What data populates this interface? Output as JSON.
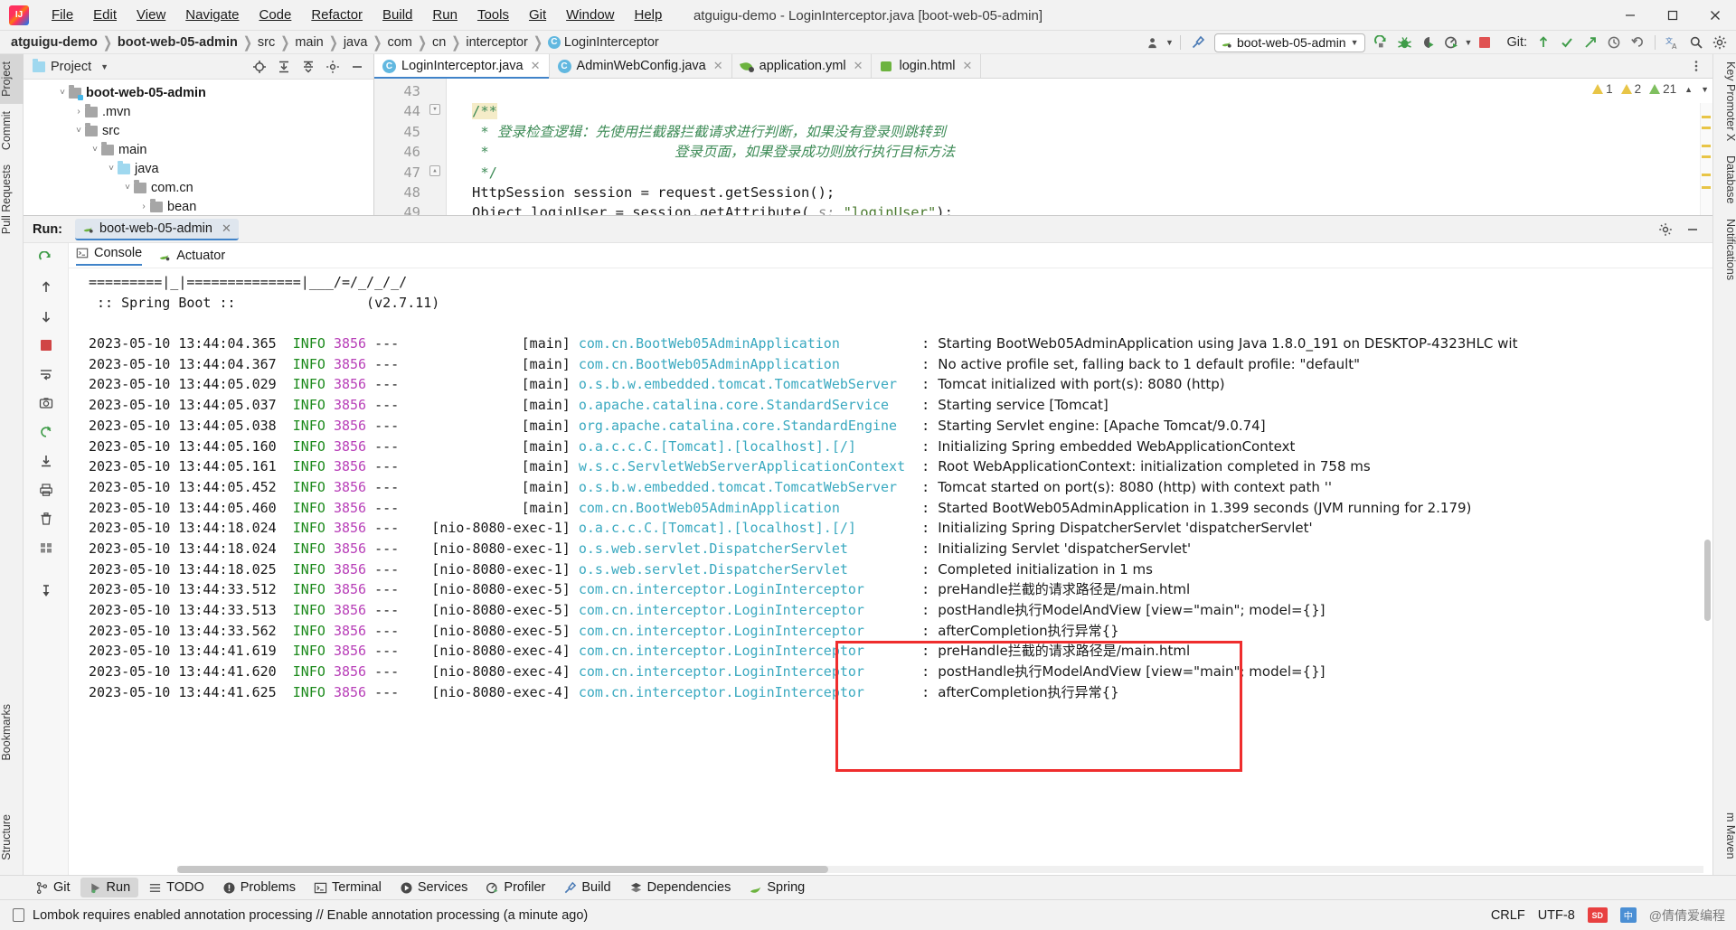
{
  "window": {
    "title": "atguigu-demo - LoginInterceptor.java [boot-web-05-admin]",
    "minimize": "–",
    "maximize": "❐",
    "close": "✕"
  },
  "menubar": {
    "items": [
      "File",
      "Edit",
      "View",
      "Navigate",
      "Code",
      "Refactor",
      "Build",
      "Run",
      "Tools",
      "Git",
      "Window",
      "Help"
    ]
  },
  "breadcrumb": {
    "items": [
      {
        "label": "atguigu-demo",
        "bold": true
      },
      {
        "label": "boot-web-05-admin",
        "bold": true
      },
      {
        "label": "src",
        "bold": false
      },
      {
        "label": "main",
        "bold": false
      },
      {
        "label": "java",
        "bold": false
      },
      {
        "label": "com",
        "bold": false
      },
      {
        "label": "cn",
        "bold": false
      },
      {
        "label": "interceptor",
        "bold": false
      },
      {
        "label": "LoginInterceptor",
        "bold": false,
        "icon": "C"
      }
    ]
  },
  "navbar_right": {
    "run_configuration": "boot-web-05-admin",
    "git_label": "Git:",
    "icons": [
      "user-icon",
      "build-hammer-icon",
      "rerun-icon",
      "debug-bug-icon",
      "coverage-icon",
      "profiler-icon",
      "stop-icon",
      "git-update-icon",
      "git-commit-icon",
      "git-push-icon",
      "git-history-icon",
      "git-revert-icon",
      "translate-icon",
      "search-icon",
      "settings-gear-icon"
    ]
  },
  "left_strip": {
    "tabs": [
      {
        "label": "Project",
        "active": true
      },
      {
        "label": "Commit",
        "active": false
      },
      {
        "label": "Pull Requests",
        "active": false
      },
      {
        "label": "Bookmarks",
        "active": false
      },
      {
        "label": "Structure",
        "active": false
      }
    ]
  },
  "right_strip": {
    "tabs": [
      "Key Promoter X",
      "Database",
      "Notifications",
      "m Maven"
    ]
  },
  "project_panel": {
    "title": "Project",
    "header_icons": [
      "locate-icon",
      "expand-all-icon",
      "collapse-all-icon",
      "settings-icon",
      "hide-icon"
    ],
    "tree": [
      {
        "label": "boot-web-05-admin",
        "depth": 1,
        "arrow": "⌄",
        "bold": true,
        "folder": "module"
      },
      {
        "label": ".mvn",
        "depth": 2,
        "arrow": "›",
        "bold": false,
        "folder": "gray"
      },
      {
        "label": "src",
        "depth": 2,
        "arrow": "⌄",
        "bold": false,
        "folder": "gray"
      },
      {
        "label": "main",
        "depth": 3,
        "arrow": "⌄",
        "bold": false,
        "folder": "gray"
      },
      {
        "label": "java",
        "depth": 4,
        "arrow": "⌄",
        "bold": false,
        "folder": "blue"
      },
      {
        "label": "com.cn",
        "depth": 5,
        "arrow": "⌄",
        "bold": false,
        "folder": "gray"
      },
      {
        "label": "bean",
        "depth": 6,
        "arrow": "›",
        "bold": false,
        "folder": "gray"
      }
    ]
  },
  "editor": {
    "tabs": [
      {
        "label": "LoginInterceptor.java",
        "icon": "java-class-icon",
        "active": true
      },
      {
        "label": "AdminWebConfig.java",
        "icon": "java-class-icon",
        "active": false
      },
      {
        "label": "application.yml",
        "icon": "spring-yaml-icon",
        "active": false
      },
      {
        "label": "login.html",
        "icon": "html-icon",
        "active": false
      }
    ],
    "inspections": {
      "warnings_1": "1",
      "warnings_2": "2",
      "weak_warnings": "21"
    },
    "line_numbers": [
      "43",
      "44",
      "45",
      "46",
      "47",
      "48",
      "49"
    ],
    "lines": [
      {
        "num": "43",
        "segments": []
      },
      {
        "num": "44",
        "segments": [
          {
            "t": "/**",
            "c": "cmt-hl"
          }
        ]
      },
      {
        "num": "45",
        "segments": [
          {
            "t": " * ",
            "c": "cmt"
          },
          {
            "t": "登录检查逻辑：先使用拦截器拦截请求进行判断，如果没有登录则跳转到",
            "c": "cmt cjk"
          }
        ]
      },
      {
        "num": "46",
        "segments": [
          {
            "t": " *                      ",
            "c": "cmt"
          },
          {
            "t": "登录页面，如果登录成功则放行执行目标方法",
            "c": "cmt cjk"
          }
        ]
      },
      {
        "num": "47",
        "segments": [
          {
            "t": " */",
            "c": "cmt"
          }
        ]
      },
      {
        "num": "48",
        "segments": [
          {
            "t": "HttpSession session = request.getSession();",
            "c": "kw"
          }
        ]
      },
      {
        "num": "49",
        "segments": [
          {
            "t": "Object loginUser = session.getAttribute( ",
            "c": "kw"
          },
          {
            "t": "s:",
            "c": "param"
          },
          {
            "t": " ",
            "c": "kw"
          },
          {
            "t": "\"loginUser\"",
            "c": "str"
          },
          {
            "t": ");",
            "c": "kw"
          }
        ]
      }
    ]
  },
  "run_panel": {
    "label": "Run:",
    "config_tab": "boot-web-05-admin",
    "subtabs": [
      {
        "label": "Console",
        "icon": "console-icon",
        "active": true
      },
      {
        "label": "Actuator",
        "icon": "actuator-icon",
        "active": false
      }
    ],
    "side_icons": [
      "rerun-icon",
      "scroll-up-icon",
      "scroll-down-icon",
      "stop-icon",
      "soft-wrap-icon",
      "screenshot-icon",
      "restart-icon",
      "scroll-end-icon",
      "print-icon",
      "clear-all-icon",
      "grid-icon",
      "pin-icon"
    ],
    "header_icons": [
      "settings-gear-icon",
      "hide-icon"
    ],
    "banner_lines": [
      "=========|_|==============|___/=/_/_/_/",
      " :: Spring Boot ::                (v2.7.11)"
    ],
    "log": [
      {
        "date": "2023-05-10 13:44:04.365",
        "level": "INFO",
        "pid": "3856",
        "thread": "main",
        "logger": "com.cn.BootWeb05AdminApplication",
        "msg": "Starting BootWeb05AdminApplication using Java 1.8.0_191 on DESKTOP-4323HLC wit",
        "highlight": false
      },
      {
        "date": "2023-05-10 13:44:04.367",
        "level": "INFO",
        "pid": "3856",
        "thread": "main",
        "logger": "com.cn.BootWeb05AdminApplication",
        "msg": "No active profile set, falling back to 1 default profile: \"default\"",
        "highlight": false
      },
      {
        "date": "2023-05-10 13:44:05.029",
        "level": "INFO",
        "pid": "3856",
        "thread": "main",
        "logger": "o.s.b.w.embedded.tomcat.TomcatWebServer",
        "msg": "Tomcat initialized with port(s): 8080 (http)",
        "highlight": false
      },
      {
        "date": "2023-05-10 13:44:05.037",
        "level": "INFO",
        "pid": "3856",
        "thread": "main",
        "logger": "o.apache.catalina.core.StandardService",
        "msg": "Starting service [Tomcat]",
        "highlight": false
      },
      {
        "date": "2023-05-10 13:44:05.038",
        "level": "INFO",
        "pid": "3856",
        "thread": "main",
        "logger": "org.apache.catalina.core.StandardEngine",
        "msg": "Starting Servlet engine: [Apache Tomcat/9.0.74]",
        "highlight": false
      },
      {
        "date": "2023-05-10 13:44:05.160",
        "level": "INFO",
        "pid": "3856",
        "thread": "main",
        "logger": "o.a.c.c.C.[Tomcat].[localhost].[/]",
        "msg": "Initializing Spring embedded WebApplicationContext",
        "highlight": false
      },
      {
        "date": "2023-05-10 13:44:05.161",
        "level": "INFO",
        "pid": "3856",
        "thread": "main",
        "logger": "w.s.c.ServletWebServerApplicationContext",
        "msg": "Root WebApplicationContext: initialization completed in 758 ms",
        "highlight": false
      },
      {
        "date": "2023-05-10 13:44:05.452",
        "level": "INFO",
        "pid": "3856",
        "thread": "main",
        "logger": "o.s.b.w.embedded.tomcat.TomcatWebServer",
        "msg": "Tomcat started on port(s): 8080 (http) with context path ''",
        "highlight": false
      },
      {
        "date": "2023-05-10 13:44:05.460",
        "level": "INFO",
        "pid": "3856",
        "thread": "main",
        "logger": "com.cn.BootWeb05AdminApplication",
        "msg": "Started BootWeb05AdminApplication in 1.399 seconds (JVM running for 2.179)",
        "highlight": false
      },
      {
        "date": "2023-05-10 13:44:18.024",
        "level": "INFO",
        "pid": "3856",
        "thread": "nio-8080-exec-1",
        "logger": "o.a.c.c.C.[Tomcat].[localhost].[/]",
        "msg": "Initializing Spring DispatcherServlet 'dispatcherServlet'",
        "highlight": false
      },
      {
        "date": "2023-05-10 13:44:18.024",
        "level": "INFO",
        "pid": "3856",
        "thread": "nio-8080-exec-1",
        "logger": "o.s.web.servlet.DispatcherServlet",
        "msg": "Initializing Servlet 'dispatcherServlet'",
        "highlight": false
      },
      {
        "date": "2023-05-10 13:44:18.025",
        "level": "INFO",
        "pid": "3856",
        "thread": "nio-8080-exec-1",
        "logger": "o.s.web.servlet.DispatcherServlet",
        "msg": "Completed initialization in 1 ms",
        "highlight": false
      },
      {
        "date": "2023-05-10 13:44:33.512",
        "level": "INFO",
        "pid": "3856",
        "thread": "nio-8080-exec-5",
        "logger": "com.cn.interceptor.LoginInterceptor",
        "msg": "preHandle拦截的请求路径是/main.html",
        "highlight": true
      },
      {
        "date": "2023-05-10 13:44:33.513",
        "level": "INFO",
        "pid": "3856",
        "thread": "nio-8080-exec-5",
        "logger": "com.cn.interceptor.LoginInterceptor",
        "msg": "postHandle执行ModelAndView [view=\"main\"; model={}]",
        "highlight": true
      },
      {
        "date": "2023-05-10 13:44:33.562",
        "level": "INFO",
        "pid": "3856",
        "thread": "nio-8080-exec-5",
        "logger": "com.cn.interceptor.LoginInterceptor",
        "msg": "afterCompletion执行异常{}",
        "highlight": true
      },
      {
        "date": "2023-05-10 13:44:41.619",
        "level": "INFO",
        "pid": "3856",
        "thread": "nio-8080-exec-4",
        "logger": "com.cn.interceptor.LoginInterceptor",
        "msg": "preHandle拦截的请求路径是/main.html",
        "highlight": true
      },
      {
        "date": "2023-05-10 13:44:41.620",
        "level": "INFO",
        "pid": "3856",
        "thread": "nio-8080-exec-4",
        "logger": "com.cn.interceptor.LoginInterceptor",
        "msg": "postHandle执行ModelAndView [view=\"main\"; model={}]",
        "highlight": true
      },
      {
        "date": "2023-05-10 13:44:41.625",
        "level": "INFO",
        "pid": "3856",
        "thread": "nio-8080-exec-4",
        "logger": "com.cn.interceptor.LoginInterceptor",
        "msg": "afterCompletion执行异常{}",
        "highlight": true
      }
    ]
  },
  "tool_windows": {
    "items": [
      {
        "label": "Git",
        "icon": "git-branch-icon",
        "active": false
      },
      {
        "label": "Run",
        "icon": "run-play-icon",
        "active": true
      },
      {
        "label": "TODO",
        "icon": "todo-list-icon",
        "active": false
      },
      {
        "label": "Problems",
        "icon": "problems-icon",
        "active": false
      },
      {
        "label": "Terminal",
        "icon": "terminal-icon",
        "active": false
      },
      {
        "label": "Services",
        "icon": "services-icon",
        "active": false
      },
      {
        "label": "Profiler",
        "icon": "profiler-icon",
        "active": false
      },
      {
        "label": "Build",
        "icon": "build-hammer-icon",
        "active": false
      },
      {
        "label": "Dependencies",
        "icon": "dependencies-icon",
        "active": false
      },
      {
        "label": "Spring",
        "icon": "spring-leaf-icon",
        "active": false
      }
    ]
  },
  "statusbar": {
    "message": "Lombok requires enabled annotation processing // Enable annotation processing (a minute ago)",
    "line_separator": "CRLF",
    "encoding": "UTF-8",
    "watermark_logo": "SD",
    "watermark_text": "@倩倩爱编程",
    "watermark_cn": "中"
  },
  "colors": {
    "accent_blue": "#4083c9",
    "green": "#59a869",
    "red_box": "#ef2d2d",
    "log_logger": "#3aa9c0",
    "log_info": "#1c8a1c",
    "log_pid": "#b83fb8",
    "comment_green": "#3d8b56"
  }
}
